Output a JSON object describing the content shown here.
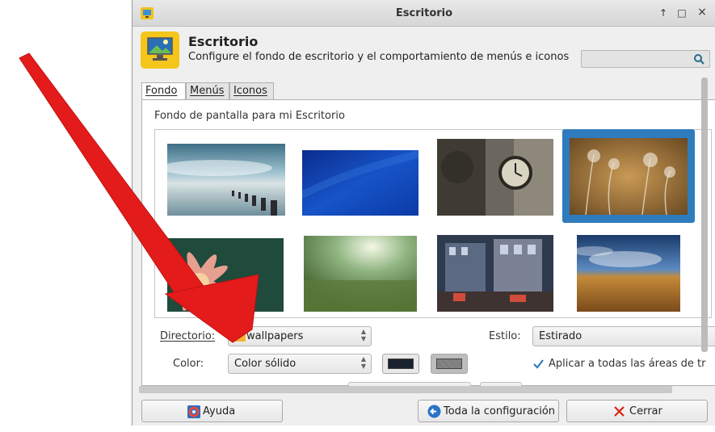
{
  "window": {
    "title": "Escritorio",
    "buttons": {
      "up": "↑",
      "maximize": "□",
      "close": "×"
    }
  },
  "header": {
    "title": "Escritorio",
    "subtitle": "Configure el fondo de escritorio y el comportamiento de menús e iconos",
    "search_placeholder": ""
  },
  "tabs": [
    {
      "label": "Fondo",
      "active": true
    },
    {
      "label": "Menús",
      "active": false
    },
    {
      "label": "Iconos",
      "active": false
    }
  ],
  "wallpapers": {
    "section_label": "Fondo de pantalla para mi Escritorio",
    "items": [
      {
        "name": "lake-pier",
        "selected": false
      },
      {
        "name": "blue-gradient",
        "selected": false
      },
      {
        "name": "street-clock",
        "selected": false
      },
      {
        "name": "dry-grass",
        "selected": true
      },
      {
        "name": "pink-flower",
        "selected": false
      },
      {
        "name": "green-meadow",
        "selected": false
      },
      {
        "name": "graffiti-building",
        "selected": false
      },
      {
        "name": "wheat-field",
        "selected": false
      }
    ]
  },
  "directory": {
    "label": "Directorio:",
    "value": "wallpapers"
  },
  "style": {
    "label": "Estilo:",
    "value": "Estirado"
  },
  "color": {
    "label": "Color:",
    "value": "Color sólido",
    "primary": "#1a2230",
    "secondary": "#808080"
  },
  "apply_all": {
    "label": "Aplicar a todas las áreas de tr",
    "checked": true
  },
  "footer": {
    "help": "Ayuda",
    "all_settings": "Toda la configuración",
    "close": "Cerrar"
  },
  "colors": {
    "accent": "#2e7bbd",
    "annotation_arrow": "#e41b1b",
    "close_x": "#d9230f"
  }
}
